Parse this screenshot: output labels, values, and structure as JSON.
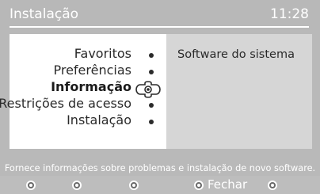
{
  "header": {
    "title": "Instalação",
    "clock": "11:28"
  },
  "menu": {
    "items": [
      {
        "label": "Favoritos",
        "selected": false
      },
      {
        "label": "Preferências",
        "selected": false
      },
      {
        "label": "Informação",
        "selected": true
      },
      {
        "label": "Restrições de acesso",
        "selected": false
      },
      {
        "label": "Instalação",
        "selected": false
      }
    ],
    "selector_icon": "navigation-cross-icon",
    "bullet_icon": "bullet-dot-icon"
  },
  "info": {
    "text": "Software do sistema"
  },
  "footer": {
    "hint": "Fornece informações sobre problemas e instalação de novo software.",
    "close_label": "Fechar",
    "buttons": [
      "red-button-icon",
      "green-button-icon",
      "yellow-button-icon",
      "blue-button-icon",
      "option-button-icon"
    ]
  },
  "colors": {
    "background": "#b9b9b9",
    "menu_panel": "#ffffff",
    "info_panel": "#d6d6d6",
    "text": "#2a2a2a"
  }
}
